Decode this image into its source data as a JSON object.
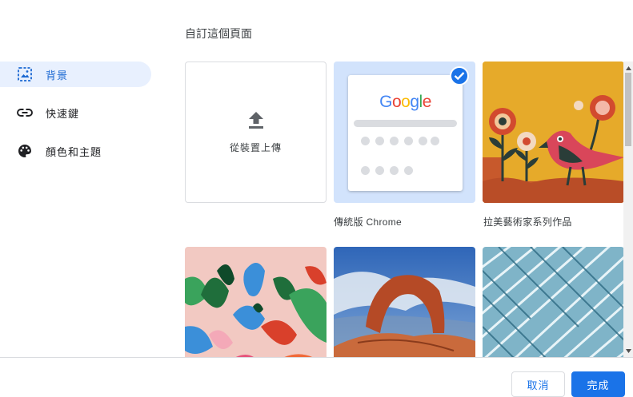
{
  "dialog": {
    "title": "自訂這個頁面"
  },
  "sidebar": {
    "items": [
      {
        "label": "背景",
        "icon": "image-icon",
        "selected": true
      },
      {
        "label": "快速鍵",
        "icon": "link-icon",
        "selected": false
      },
      {
        "label": "顏色和主題",
        "icon": "palette-icon",
        "selected": false
      }
    ]
  },
  "backgrounds": {
    "upload_label": "從裝置上傳",
    "classic": {
      "caption": "傳統版 Chrome",
      "logo_text": "Google",
      "selected": true
    },
    "art": {
      "caption": "拉美藝術家系列作品"
    }
  },
  "footer": {
    "cancel_label": "取消",
    "done_label": "完成"
  },
  "colors": {
    "accent": "#1a73e8",
    "selected_nav_bg": "#e8f0fe",
    "classic_bg": "#d2e3fc"
  }
}
